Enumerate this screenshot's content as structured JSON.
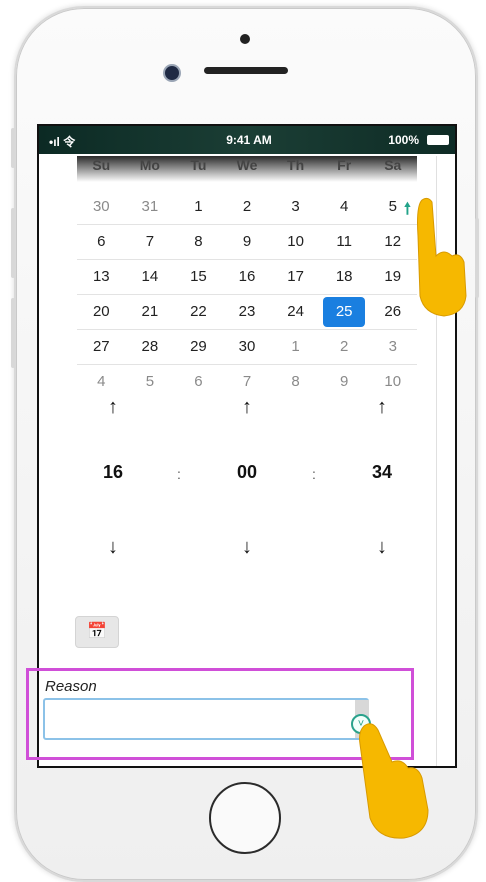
{
  "status_bar": {
    "signal": "•ıl 令",
    "time": "9:41 AM",
    "battery": "100%"
  },
  "calendar": {
    "weekdays": [
      "Su",
      "Mo",
      "Tu",
      "We",
      "Th",
      "Fr",
      "Sa"
    ],
    "weeks": [
      [
        {
          "d": "30",
          "m": true
        },
        {
          "d": "31",
          "m": true
        },
        {
          "d": "1"
        },
        {
          "d": "2"
        },
        {
          "d": "3"
        },
        {
          "d": "4"
        },
        {
          "d": "5"
        }
      ],
      [
        {
          "d": "6"
        },
        {
          "d": "7"
        },
        {
          "d": "8"
        },
        {
          "d": "9"
        },
        {
          "d": "10"
        },
        {
          "d": "11"
        },
        {
          "d": "12"
        }
      ],
      [
        {
          "d": "13"
        },
        {
          "d": "14"
        },
        {
          "d": "15"
        },
        {
          "d": "16"
        },
        {
          "d": "17"
        },
        {
          "d": "18"
        },
        {
          "d": "19"
        }
      ],
      [
        {
          "d": "20"
        },
        {
          "d": "21"
        },
        {
          "d": "22"
        },
        {
          "d": "23"
        },
        {
          "d": "24"
        },
        {
          "d": "25",
          "selected": true
        },
        {
          "d": "26"
        }
      ],
      [
        {
          "d": "27"
        },
        {
          "d": "28"
        },
        {
          "d": "29"
        },
        {
          "d": "30"
        },
        {
          "d": "1",
          "m": true
        },
        {
          "d": "2",
          "m": true
        },
        {
          "d": "3",
          "m": true
        }
      ],
      [
        {
          "d": "4",
          "m": true
        },
        {
          "d": "5",
          "m": true
        },
        {
          "d": "6",
          "m": true
        },
        {
          "d": "7",
          "m": true
        },
        {
          "d": "8",
          "m": true
        },
        {
          "d": "9",
          "m": true
        },
        {
          "d": "10",
          "m": true
        }
      ]
    ],
    "selected_color": "#1a7fe0"
  },
  "time_picker": {
    "hours": "16",
    "minutes": "00",
    "seconds": "34",
    "separator": ":",
    "up_icon": "arrow-up-icon",
    "down_icon": "arrow-down-icon"
  },
  "calendar_toggle_icon": "calendar-icon",
  "reason": {
    "label": "Reason",
    "value": ""
  },
  "colors": {
    "highlight": "#d04fd8",
    "hand": "#f6b800",
    "teal": "#2aa28c"
  }
}
